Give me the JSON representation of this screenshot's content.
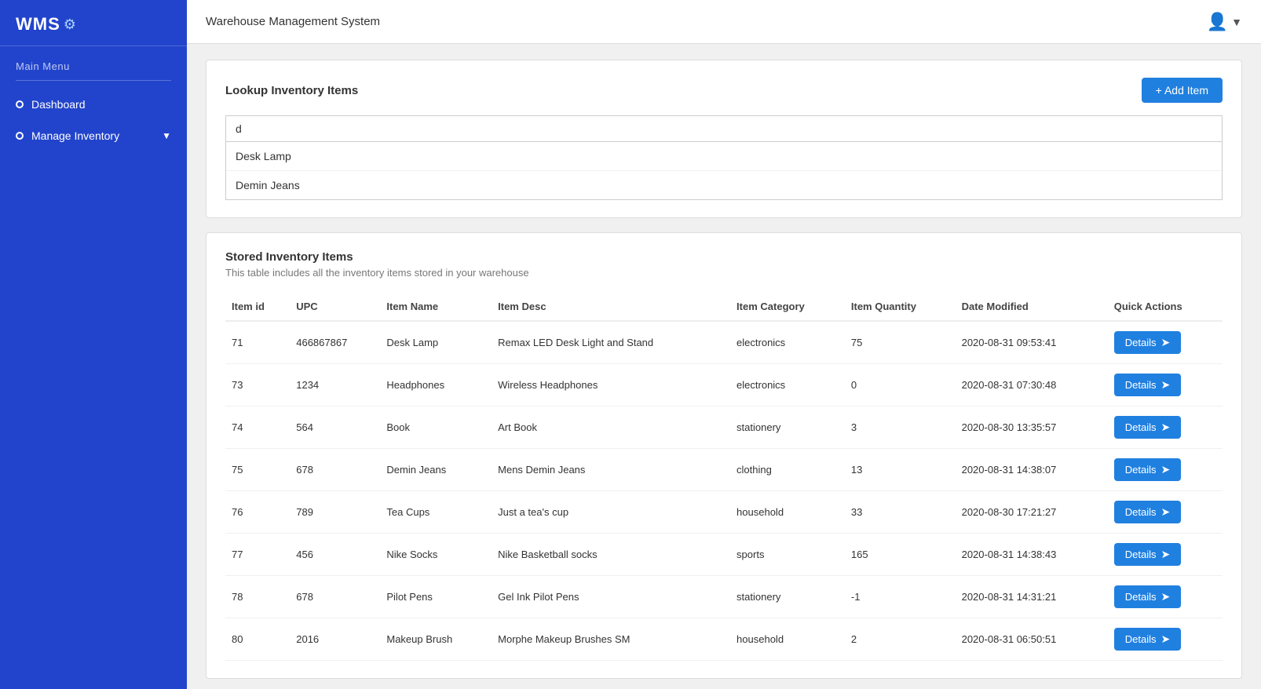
{
  "app": {
    "title": "Warehouse Management System",
    "logo": "WMS",
    "logo_gear": "⚙"
  },
  "sidebar": {
    "main_menu_label": "Main Menu",
    "items": [
      {
        "id": "dashboard",
        "label": "Dashboard",
        "has_dot": true,
        "has_chevron": false
      },
      {
        "id": "manage-inventory",
        "label": "Manage Inventory",
        "has_dot": true,
        "has_chevron": true
      }
    ]
  },
  "topbar": {
    "title": "Warehouse Management System"
  },
  "lookup": {
    "title": "Lookup Inventory Items",
    "add_button_label": "+ Add Item",
    "search_value": "d",
    "search_placeholder": "",
    "dropdown_items": [
      {
        "label": "Desk Lamp"
      },
      {
        "label": "Demin Jeans"
      }
    ]
  },
  "table_section": {
    "title": "Stored Inventory Items",
    "subtitle": "This table includes all the inventory items stored in your warehouse",
    "columns": [
      "Item id",
      "UPC",
      "Item Name",
      "Item Desc",
      "Item Category",
      "Item Quantity",
      "Date Modified",
      "Quick Actions"
    ],
    "details_button_label": "Details",
    "rows": [
      {
        "id": "71",
        "upc": "466867867",
        "name": "Desk Lamp",
        "desc": "Remax LED Desk Light and Stand",
        "category": "electronics",
        "quantity": "75",
        "date_modified": "2020-08-31 09:53:41"
      },
      {
        "id": "73",
        "upc": "1234",
        "name": "Headphones",
        "desc": "Wireless Headphones",
        "category": "electronics",
        "quantity": "0",
        "date_modified": "2020-08-31 07:30:48"
      },
      {
        "id": "74",
        "upc": "564",
        "name": "Book",
        "desc": "Art Book",
        "category": "stationery",
        "quantity": "3",
        "date_modified": "2020-08-30 13:35:57"
      },
      {
        "id": "75",
        "upc": "678",
        "name": "Demin Jeans",
        "desc": "Mens Demin Jeans",
        "category": "clothing",
        "quantity": "13",
        "date_modified": "2020-08-31 14:38:07"
      },
      {
        "id": "76",
        "upc": "789",
        "name": "Tea Cups",
        "desc": "Just a tea's cup",
        "category": "household",
        "quantity": "33",
        "date_modified": "2020-08-30 17:21:27"
      },
      {
        "id": "77",
        "upc": "456",
        "name": "Nike Socks",
        "desc": "Nike Basketball socks",
        "category": "sports",
        "quantity": "165",
        "date_modified": "2020-08-31 14:38:43"
      },
      {
        "id": "78",
        "upc": "678",
        "name": "Pilot Pens",
        "desc": "Gel Ink Pilot Pens",
        "category": "stationery",
        "quantity": "-1",
        "date_modified": "2020-08-31 14:31:21"
      },
      {
        "id": "80",
        "upc": "2016",
        "name": "Makeup Brush",
        "desc": "Morphe Makeup Brushes SM",
        "category": "household",
        "quantity": "2",
        "date_modified": "2020-08-31 06:50:51"
      }
    ]
  }
}
